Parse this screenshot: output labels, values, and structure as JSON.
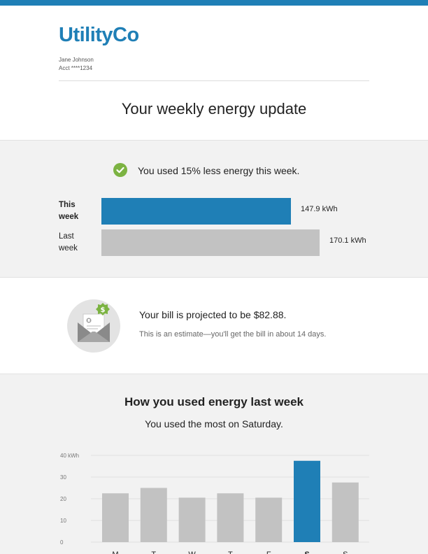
{
  "brand": {
    "name": "UtilityCo",
    "accent": "#1f7fb6"
  },
  "account": {
    "name": "Jane Johnson",
    "number": "Acct ****1234"
  },
  "page_title": "Your weekly energy update",
  "comparison": {
    "icon": "check-circle-icon",
    "message": "You used 15% less energy this week.",
    "rows": [
      {
        "label": "This week",
        "value": 147.9,
        "value_text": "147.9 kWh",
        "color": "#1f7fb6"
      },
      {
        "label": "Last week",
        "value": 170.1,
        "value_text": "170.1 kWh",
        "color": "#c2c2c2"
      }
    ]
  },
  "bill": {
    "icon": "bill-envelope-icon",
    "title": "Your bill is projected to be $82.88.",
    "note": "This is an estimate—you'll get the bill in about 14 days."
  },
  "usage": {
    "title": "How you used energy last week",
    "subtitle": "You used the most on Saturday."
  },
  "chart_data": {
    "type": "bar",
    "categories": [
      "M",
      "T",
      "W",
      "T",
      "F",
      "S",
      "S"
    ],
    "values": [
      22.5,
      25,
      20.5,
      22.5,
      20.5,
      37.5,
      27.5
    ],
    "highlight_index": 5,
    "highlight_color": "#1f7fb6",
    "bar_color": "#c2c2c2",
    "y_ticks": [
      "40 kWh",
      "30",
      "20",
      "10",
      "0"
    ],
    "ylim": [
      0,
      40
    ],
    "grid": true
  }
}
